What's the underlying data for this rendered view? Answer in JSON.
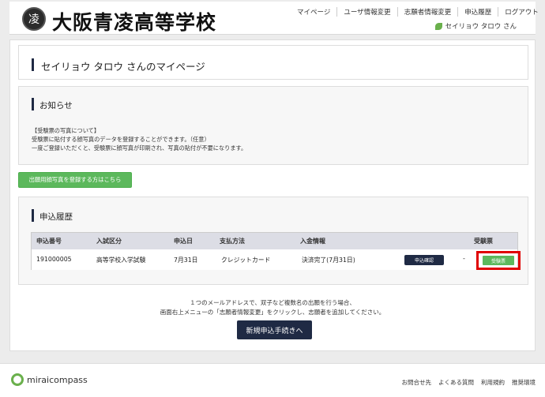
{
  "header": {
    "emblem_char": "凌",
    "school_name": "大阪青凌高等学校",
    "nav": [
      "マイページ",
      "ユーザ情報変更",
      "志願者情報変更",
      "申込履歴",
      "ログアウト"
    ],
    "user_name": "セイリョウ タロウ さん"
  },
  "page": {
    "title": "セイリョウ タロウ さんのマイページ"
  },
  "notice": {
    "title": "お知らせ",
    "lines": [
      "【受験票の写真について】",
      "受験票に貼付する顔写真のデータを登録することができます。（任意）",
      "一度ご登録いただくと、受験票に顔写真が印刷され、写真の貼付が不要になります。"
    ]
  },
  "photo_button_label": "出願用顔写真を登録する方はこちら",
  "history": {
    "title": "申込履歴",
    "columns": [
      "申込番号",
      "入試区分",
      "申込日",
      "支払方法",
      "入金情報",
      "受験票"
    ],
    "rows": [
      {
        "number": "191000005",
        "category": "高等学校入学試験",
        "date": "7月31日",
        "payment_method": "クレジットカード",
        "payment_info": "決済完了(7月31日)",
        "detail_label": "申込確認",
        "dash": "-",
        "voucher_label": "受験票"
      }
    ]
  },
  "info": {
    "line1": "１つのメールアドレスで、双子など複数名の出願を行う場合、",
    "line2": "画面右上メニューの「志願者情報変更」をクリックし、志願者を追加してください。"
  },
  "new_application_label": "新規申込手続きへ",
  "footer": {
    "logo_text": "miraicompass",
    "links": [
      "お問合せ先",
      "よくある質問",
      "利用規約",
      "推奨環境"
    ]
  },
  "colors": {
    "navy": "#1f2a44",
    "green": "#5cb85c",
    "highlight_red": "#e00000"
  }
}
